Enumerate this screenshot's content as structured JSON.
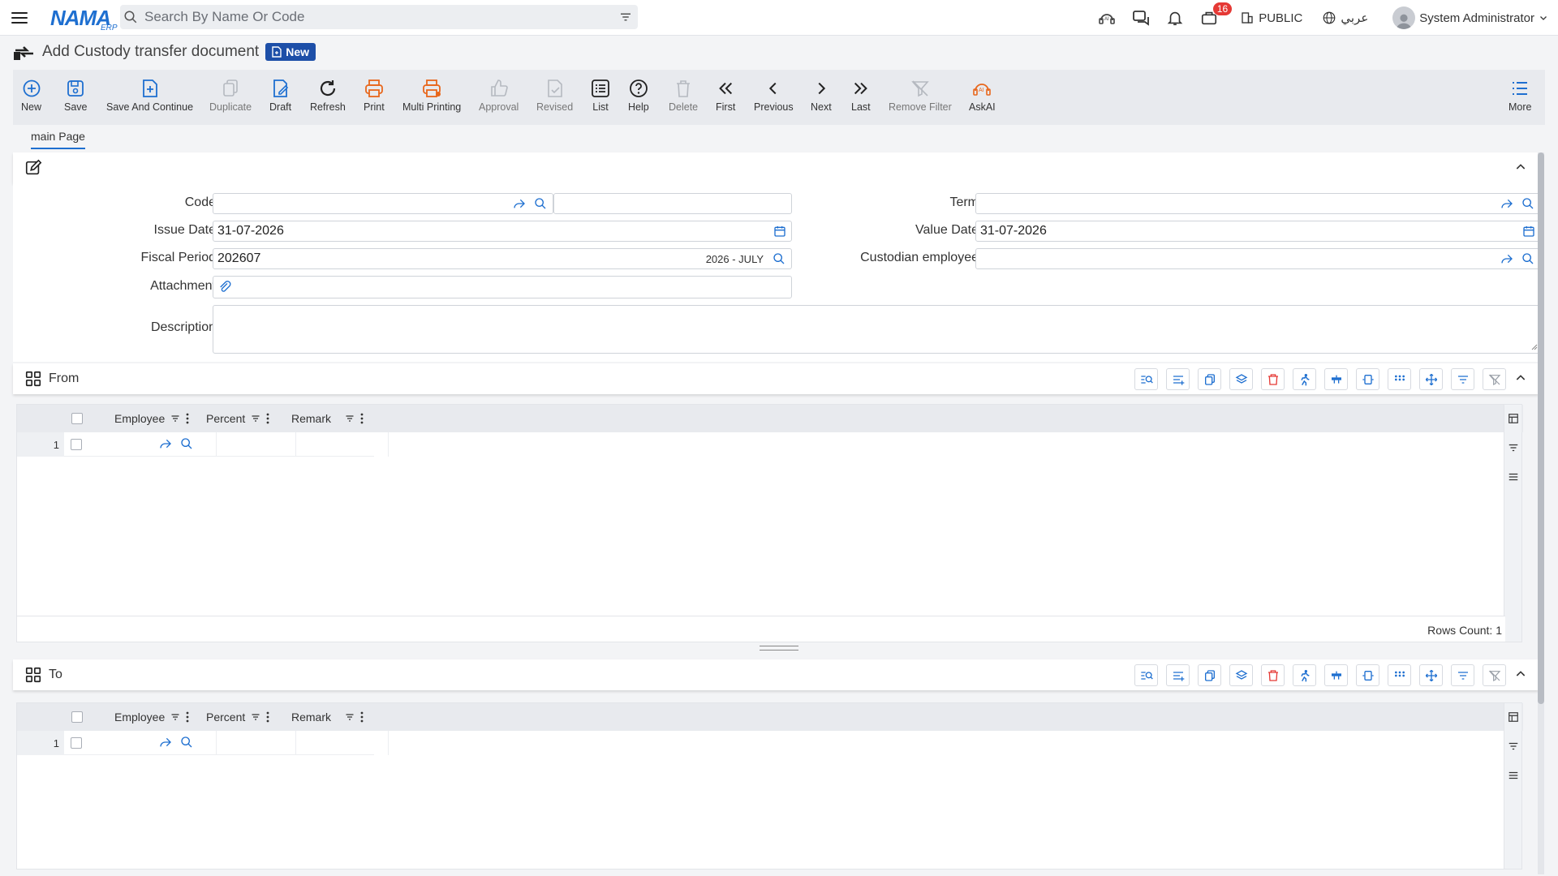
{
  "app": {
    "logo_text": "NAMA",
    "logo_sub": "ERP",
    "search_placeholder": "Search By Name Or Code",
    "notification_count": "16",
    "branch": "PUBLIC",
    "language": "عربي",
    "user": "System Administrator"
  },
  "page": {
    "title": "Add Custody transfer document",
    "status": "New"
  },
  "toolbar": [
    {
      "label": "New",
      "icon": "plus-circle-icon"
    },
    {
      "label": "Save",
      "icon": "save-icon"
    },
    {
      "label": "Save And Continue",
      "icon": "save-continue-icon"
    },
    {
      "label": "Duplicate",
      "icon": "duplicate-icon"
    },
    {
      "label": "Draft",
      "icon": "draft-icon"
    },
    {
      "label": "Refresh",
      "icon": "refresh-icon"
    },
    {
      "label": "Print",
      "icon": "print-icon"
    },
    {
      "label": "Multi Printing",
      "icon": "multi-print-icon"
    },
    {
      "label": "Approval",
      "icon": "thumbs-up-icon"
    },
    {
      "label": "Revised",
      "icon": "revised-icon"
    },
    {
      "label": "List",
      "icon": "list-icon"
    },
    {
      "label": "Help",
      "icon": "help-icon"
    },
    {
      "label": "Delete",
      "icon": "trash-icon"
    },
    {
      "label": "First",
      "icon": "double-chevron-left-icon"
    },
    {
      "label": "Previous",
      "icon": "chevron-left-icon"
    },
    {
      "label": "Next",
      "icon": "chevron-right-icon"
    },
    {
      "label": "Last",
      "icon": "double-chevron-right-icon"
    },
    {
      "label": "Remove Filter",
      "icon": "remove-filter-icon"
    },
    {
      "label": "AskAI",
      "icon": "ai-icon"
    },
    {
      "label": "More",
      "icon": "more-list-icon"
    }
  ],
  "tabs": {
    "main": "main Page"
  },
  "form": {
    "code_label": "Code",
    "code_value": "",
    "issue_date_label": "Issue Date",
    "issue_date": "31-07-2026",
    "fiscal_period_label": "Fiscal Period",
    "fiscal_period": "202607",
    "fiscal_period_name": "2026 - JULY",
    "attachment_label": "Attachment",
    "description_label": "Description",
    "term_label": "Term",
    "value_date_label": "Value Date",
    "value_date": "31-07-2026",
    "custodian_label": "Custodian employee"
  },
  "from_section": {
    "title": "From",
    "columns": [
      "Employee",
      "Percent",
      "Remark"
    ],
    "rows": [
      {
        "num": "1"
      }
    ],
    "rows_count": "Rows Count: 1"
  },
  "to_section": {
    "title": "To",
    "columns": [
      "Employee",
      "Percent",
      "Remark"
    ],
    "rows": [
      {
        "num": "1"
      }
    ]
  },
  "colors": {
    "accent": "#1e6fd0",
    "badge": "#1d4fa8",
    "orange": "#e8671c",
    "danger": "#e53935"
  }
}
